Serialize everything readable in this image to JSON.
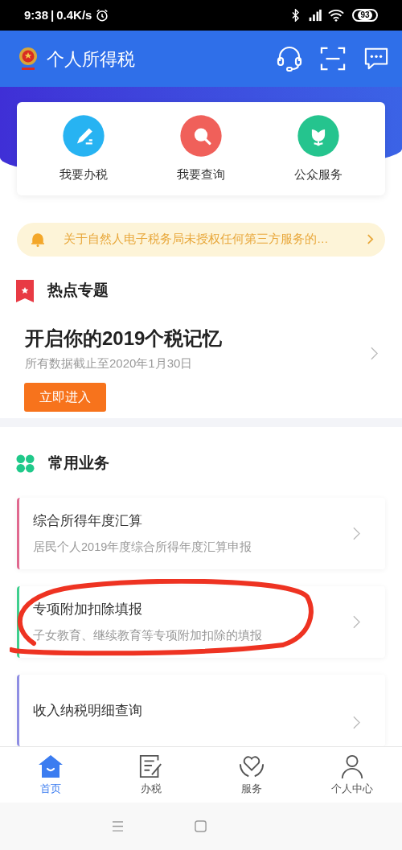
{
  "status_bar": {
    "time": "9:38",
    "separator": "|",
    "speed": "0.4K/s",
    "battery": "93"
  },
  "header": {
    "title": "个人所得税"
  },
  "quick_actions": [
    {
      "kind": "write",
      "label": "我要办税"
    },
    {
      "kind": "search",
      "label": "我要查询"
    },
    {
      "kind": "flower",
      "label": "公众服务"
    }
  ],
  "notice": {
    "text": "关于自然人电子税务局未授权任何第三方服务的…"
  },
  "hot_topics": {
    "heading": "热点专题",
    "title": "开启你的2019个税记忆",
    "subtitle": "所有数据截止至2020年1月30日",
    "button": "立即进入"
  },
  "common_services": {
    "heading": "常用业务",
    "items": [
      {
        "title": "综合所得年度汇算",
        "subtitle": "居民个人2019年度综合所得年度汇算申报",
        "color": "#e0698f",
        "circled": false
      },
      {
        "title": "专项附加扣除填报",
        "subtitle": "子女教育、继续教育等专项附加扣除的填报",
        "color": "#3fcf8e",
        "circled": true
      },
      {
        "title": "收入纳税明细查询",
        "color": "#8f8ee3",
        "circled": false
      }
    ]
  },
  "tab_bar": [
    {
      "kind": "home",
      "label": "首页",
      "selected": true
    },
    {
      "kind": "tax",
      "label": "办税",
      "selected": false
    },
    {
      "kind": "service",
      "label": "服务",
      "selected": false
    },
    {
      "kind": "profile",
      "label": "个人中心",
      "selected": false
    }
  ]
}
